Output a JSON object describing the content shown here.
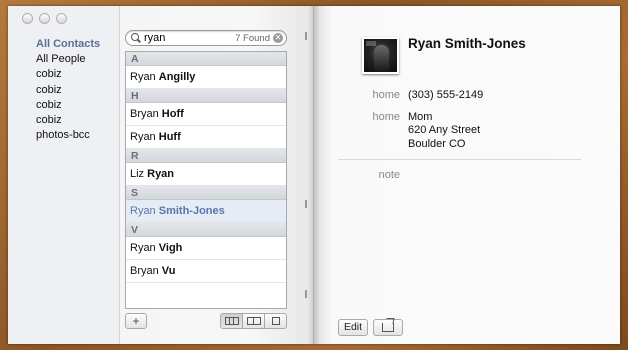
{
  "groups": {
    "items": [
      {
        "label": "All Contacts",
        "active": true
      },
      {
        "label": "All People"
      },
      {
        "label": "cobiz"
      },
      {
        "label": "cobiz"
      },
      {
        "label": "cobiz"
      },
      {
        "label": "cobiz"
      },
      {
        "label": "photos-bcc"
      }
    ]
  },
  "search": {
    "value": "ryan",
    "found_label": "7 Found",
    "clear_glyph": "✕"
  },
  "contacts": {
    "sections": [
      {
        "header": "A",
        "rows": [
          {
            "first": "Ryan",
            "last": "Angilly"
          }
        ]
      },
      {
        "header": "H",
        "rows": [
          {
            "first": "Bryan",
            "last": "Hoff"
          },
          {
            "first": "Ryan",
            "last": "Huff"
          }
        ]
      },
      {
        "header": "R",
        "rows": [
          {
            "first": "Liz",
            "last": "Ryan"
          }
        ]
      },
      {
        "header": "S",
        "rows": [
          {
            "first": "Ryan",
            "last": "Smith-Jones",
            "selected": true
          }
        ]
      },
      {
        "header": "V",
        "rows": [
          {
            "first": "Ryan",
            "last": "Vigh"
          },
          {
            "first": "Bryan",
            "last": "Vu"
          }
        ]
      }
    ]
  },
  "toolbar_left": {
    "add_label": "+"
  },
  "card": {
    "name": "Ryan Smith-Jones",
    "phone_label": "home",
    "phone_value": "(303) 555-2149",
    "address_label": "home",
    "address_line1": "Mom",
    "address_line2": "620 Any Street",
    "address_line3": "Boulder CO",
    "note_label": "note"
  },
  "toolbar_right": {
    "edit_label": "Edit"
  }
}
